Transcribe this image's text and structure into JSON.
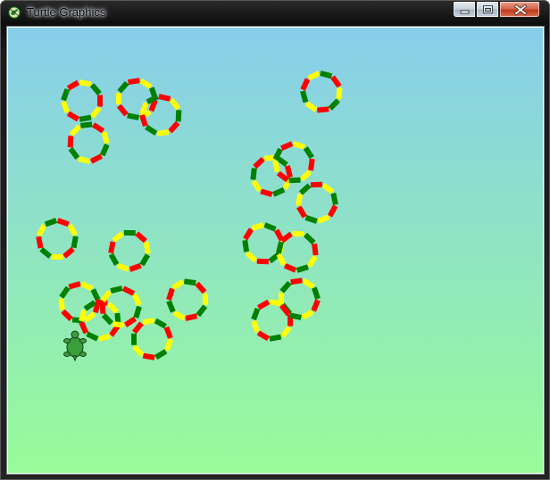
{
  "window": {
    "title": "Turtle Graphics",
    "app_icon": "python-turtle-icon",
    "controls": {
      "minimize_icon": "minimize-icon",
      "maximize_icon": "maximize-icon",
      "close_icon": "close-icon"
    }
  },
  "canvas": {
    "background_top": "#87ceeb",
    "background_bottom": "#98fb98",
    "pen_colors": [
      "#ff0000",
      "#ffff00",
      "#008000"
    ],
    "turtle_icon": "turtle-icon",
    "turtle_color": "#3a9e3a"
  }
}
